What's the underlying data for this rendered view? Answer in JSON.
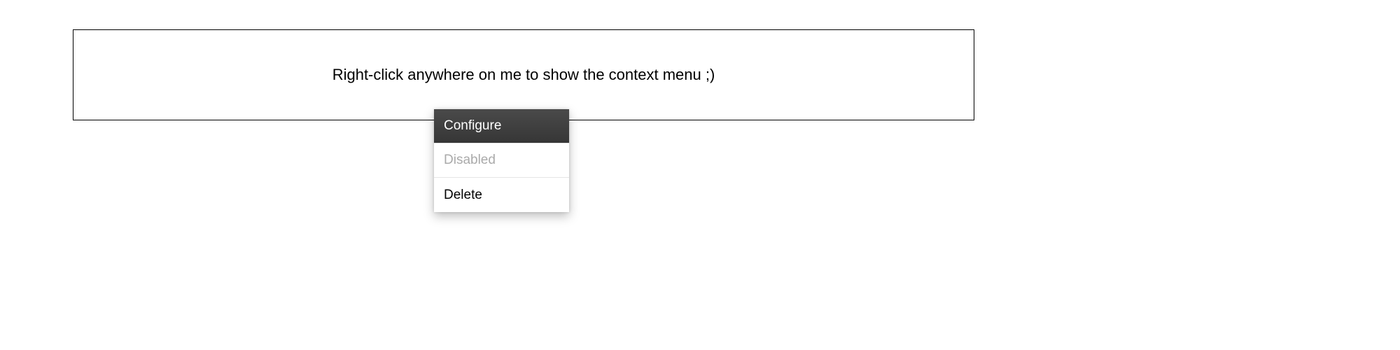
{
  "demo_box": {
    "instruction": "Right-click anywhere on me to show the context menu ;)"
  },
  "context_menu": {
    "items": [
      {
        "label": "Configure",
        "state": "hover"
      },
      {
        "label": "Disabled",
        "state": "disabled"
      },
      {
        "label": "Delete",
        "state": "normal"
      }
    ]
  }
}
